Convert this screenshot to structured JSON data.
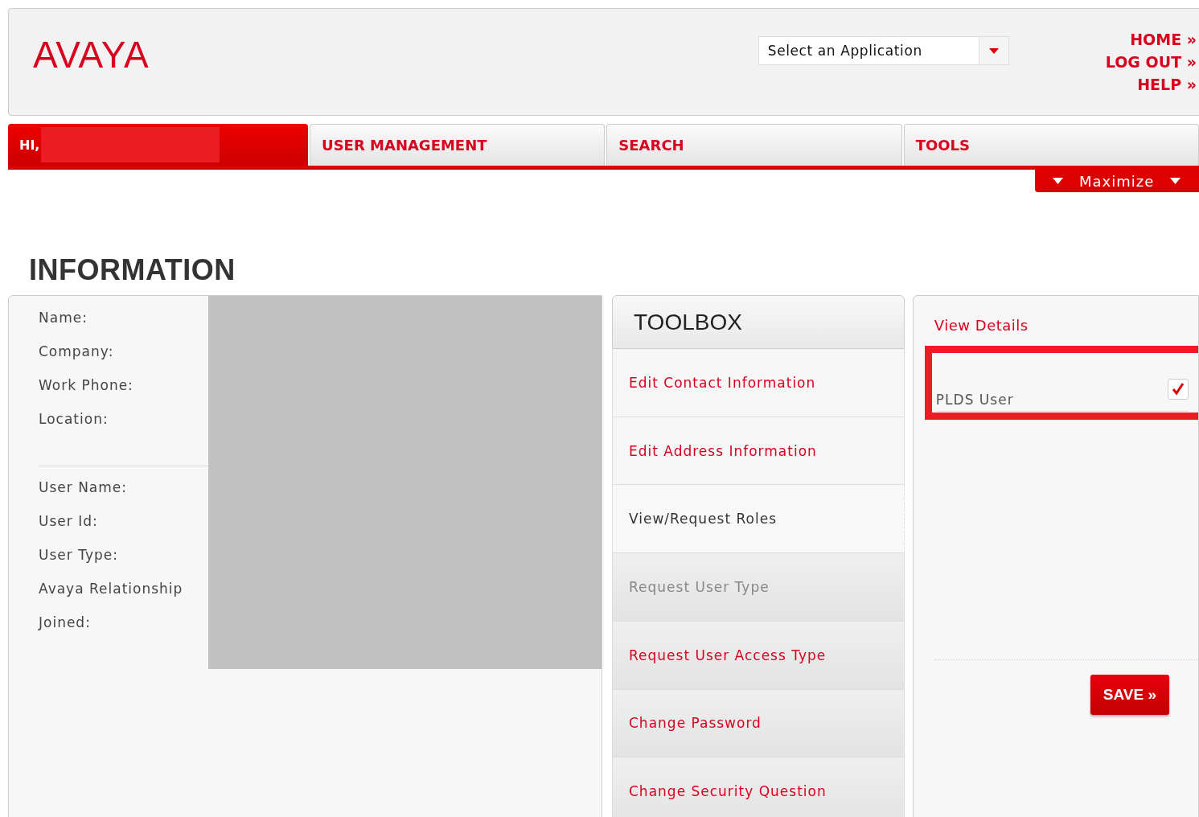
{
  "header": {
    "logo": "AVAYA",
    "app_select": {
      "value": "Select an Application"
    },
    "links": [
      "HOME »",
      "LOG OUT »",
      "HELP »"
    ]
  },
  "nav": {
    "greeting": "HI,",
    "tabs": [
      {
        "label": "USER MANAGEMENT",
        "selected": false
      },
      {
        "label": "SEARCH",
        "selected": false
      },
      {
        "label": "TOOLS",
        "selected": false
      }
    ],
    "maximize": "Maximize"
  },
  "page_title": "INFORMATION",
  "info": {
    "contact_labels": [
      "Name:",
      "Company:",
      "Work Phone:",
      "Location:"
    ],
    "account_labels": [
      "User Name:",
      "User Id:",
      "User Type:",
      "Avaya Relationship",
      "Joined:"
    ]
  },
  "toolbox": {
    "title": "TOOLBOX",
    "items": [
      {
        "label": "Edit Contact Information",
        "selected": false,
        "disabled": false
      },
      {
        "label": "Edit Address Information",
        "selected": false,
        "disabled": false
      },
      {
        "label": "View/Request Roles",
        "selected": true,
        "disabled": false
      },
      {
        "label": "Request User Type",
        "selected": false,
        "disabled": true
      },
      {
        "label": "Request User Access Type",
        "selected": false,
        "disabled": false
      },
      {
        "label": "Change Password",
        "selected": false,
        "disabled": false
      },
      {
        "label": "Change Security Question",
        "selected": false,
        "disabled": false
      }
    ]
  },
  "details": {
    "title": "View Details",
    "options": [
      {
        "label": "PLDS User",
        "checked": true
      }
    ],
    "save": "SAVE »"
  }
}
